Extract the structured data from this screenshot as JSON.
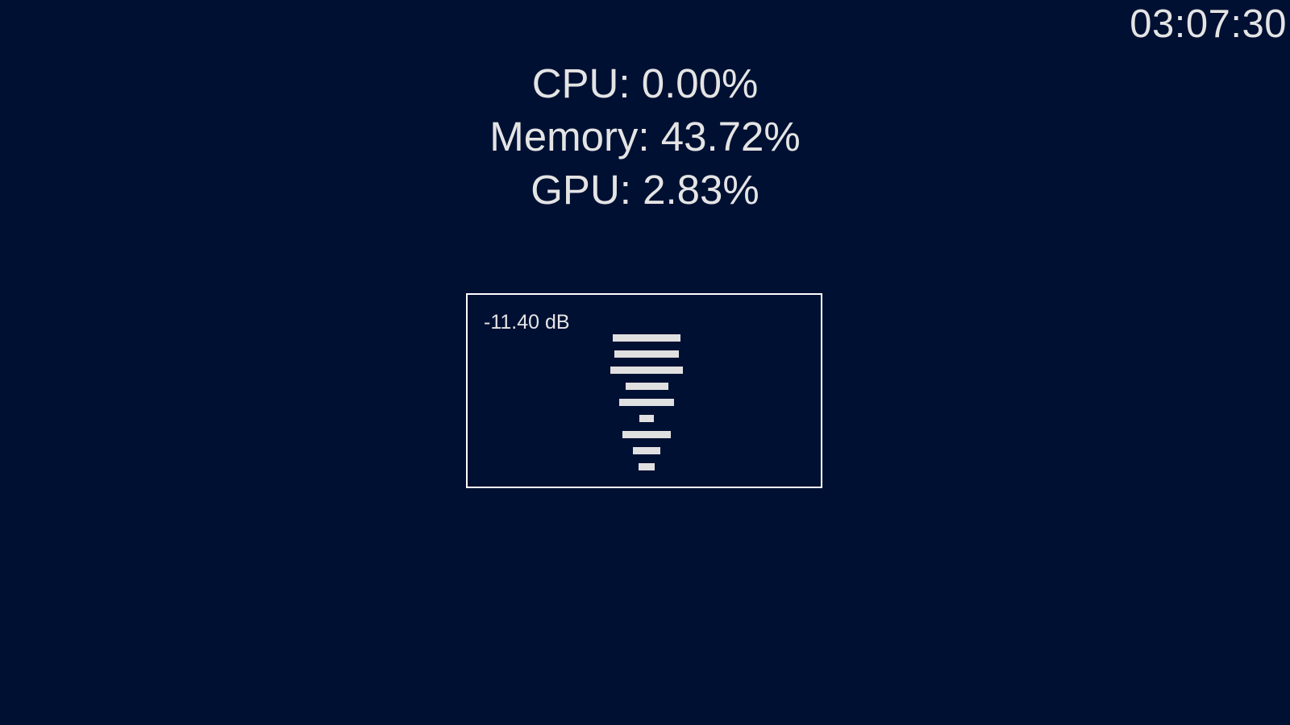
{
  "clock": {
    "time": "03:07:30"
  },
  "stats": {
    "cpu": "CPU: 0.00%",
    "memory": "Memory: 43.72%",
    "gpu": "GPU: 2.83%"
  },
  "meter": {
    "level_label": "-11.40 dB",
    "bars": [
      0.93,
      0.89,
      1.0,
      0.59,
      0.76,
      0.2,
      0.67,
      0.38,
      0.22
    ]
  },
  "colors": {
    "background": "#001033",
    "foreground": "#e4e4e4",
    "border": "#ffffff"
  }
}
